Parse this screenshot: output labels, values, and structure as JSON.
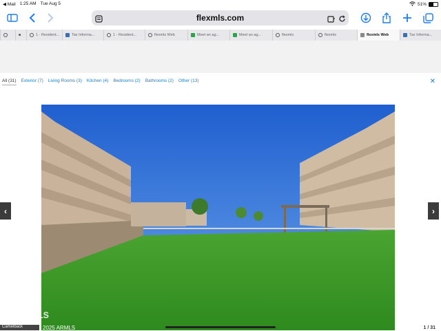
{
  "status": {
    "carrier": "◀ Mail",
    "time": "1:25 AM",
    "date": "Tue Aug 5",
    "battery": "51%",
    "battery_level": 0.51
  },
  "browser": {
    "url": "flexmls.com",
    "tabs": [
      {
        "label": "",
        "icon": "globe-icon"
      },
      {
        "label": "a",
        "icon": "amazon-icon"
      },
      {
        "label": "1 - Resident...",
        "icon": "globe-icon"
      },
      {
        "label": "Tax Informa...",
        "icon": "tax-icon"
      },
      {
        "label": "1 - Resident...",
        "icon": "globe-icon"
      },
      {
        "label": "flexmls Web",
        "icon": "globe-icon"
      },
      {
        "label": "Meet an ag...",
        "icon": "green-icon"
      },
      {
        "label": "Meet an ag...",
        "icon": "green-icon"
      },
      {
        "label": "flexmls",
        "icon": "globe-icon"
      },
      {
        "label": "flexmls",
        "icon": "globe-icon"
      },
      {
        "label": "flexmls Web",
        "icon": "gray-icon",
        "active": true
      },
      {
        "label": "Tax Informa...",
        "icon": "tax-icon"
      }
    ]
  },
  "categories": [
    {
      "label": "All (31)",
      "active": true
    },
    {
      "label": "Exterior (7)"
    },
    {
      "label": "Living Rooms (3)"
    },
    {
      "label": "Kitchen (4)"
    },
    {
      "label": "Bedrooms (2)"
    },
    {
      "label": "Bathrooms (2)"
    },
    {
      "label": "Other (13)"
    }
  ],
  "gallery": {
    "copyright": "2025 ARMLS",
    "copyright_small": "2025 ARMLS",
    "caption": "Camelback",
    "counter": "1 / 31",
    "prev_arrow": "‹",
    "next_arrow": "›",
    "close": "✕"
  },
  "colors": {
    "accent": "#1a7cf5",
    "link": "#1e7cc8",
    "sky": "#2f6fd6",
    "grass": "#3f9a2a"
  }
}
